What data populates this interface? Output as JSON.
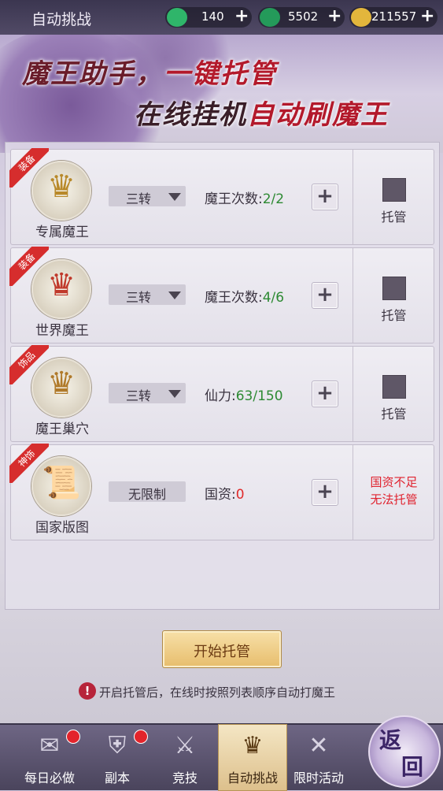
{
  "header": {
    "title": "自动挑战",
    "resources": [
      {
        "icon": "jade-icon",
        "value": "140"
      },
      {
        "icon": "jade-lock-icon",
        "value": "5502"
      },
      {
        "icon": "gold-ingot-icon",
        "value": "211557"
      }
    ]
  },
  "banner": {
    "line1_a": "魔王助手，",
    "line1_b": "一键托管",
    "line2_a": "在线挂机",
    "line2_b": "自动刷魔王"
  },
  "rows": [
    {
      "tag": "装备",
      "name": "专属魔王",
      "select": "三转",
      "stat_label": "魔王次数:",
      "stat_value": "2/2",
      "check_label": "托管",
      "icon": "demon-mask-icon"
    },
    {
      "tag": "装备",
      "name": "世界魔王",
      "select": "三转",
      "stat_label": "魔王次数:",
      "stat_value": "4/6",
      "check_label": "托管",
      "icon": "demon-mask-icon"
    },
    {
      "tag": "饰品",
      "name": "魔王巢穴",
      "select": "三转",
      "stat_label": "仙力:",
      "stat_value": "63/150",
      "check_label": "托管",
      "icon": "demon-mask-icon"
    },
    {
      "tag": "神饰",
      "name": "国家版图",
      "select": "无限制",
      "stat_label": "国资:",
      "stat_value": "0",
      "warn_line1": "国资不足",
      "warn_line2": "无法托管",
      "icon": "map-scroll-icon"
    }
  ],
  "start_button": "开始托管",
  "hint": "开启托管后，在线时按照列表顺序自动打魔王",
  "nav": [
    {
      "label": "每日必做",
      "icon": "scroll-icon",
      "badge": true
    },
    {
      "label": "副本",
      "icon": "helmet-icon",
      "badge": true
    },
    {
      "label": "竞技",
      "icon": "crossed-swords-icon",
      "badge": false
    },
    {
      "label": "自动挑战",
      "icon": "demon-crest-icon",
      "badge": false,
      "active": true
    },
    {
      "label": "限时活动",
      "icon": "crossed-blades-icon",
      "badge": false
    }
  ],
  "back": {
    "char1": "返",
    "char2": "回"
  },
  "colors": {
    "accent_red": "#e0222e",
    "value_green": "#2d8a33",
    "active_tab": "#ddc08c"
  }
}
